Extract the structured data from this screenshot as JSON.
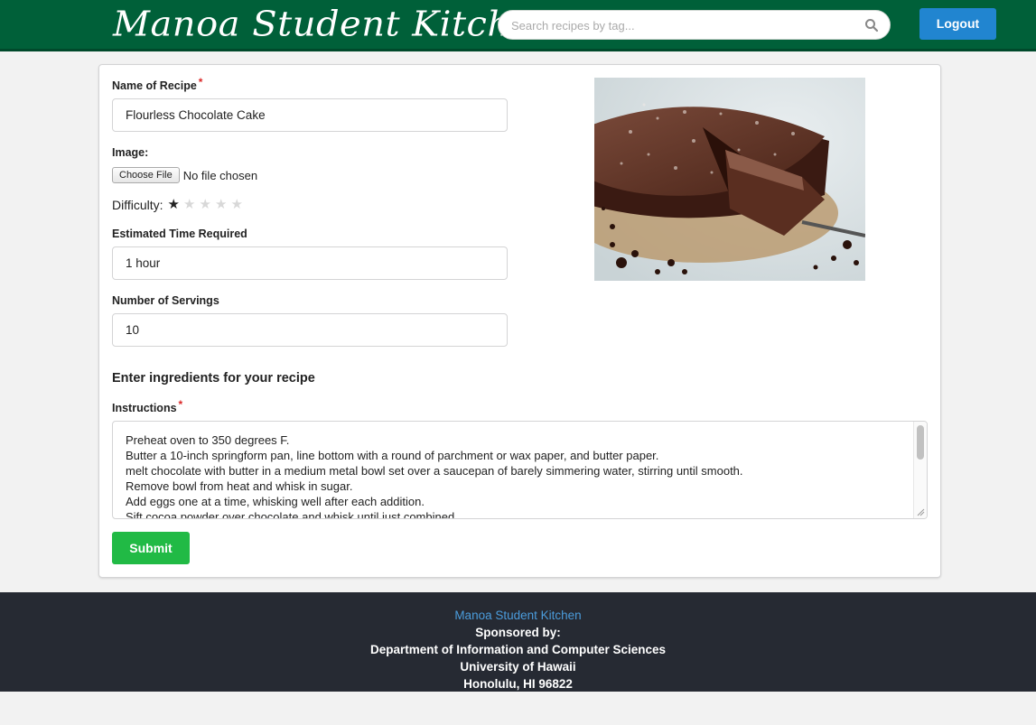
{
  "header": {
    "brand": "Manoa Student Kitchen",
    "search_placeholder": "Search recipes by tag...",
    "logout_label": "Logout"
  },
  "form": {
    "name_label": "Name of Recipe",
    "name_value": "Flourless Chocolate Cake",
    "image_label": "Image:",
    "file_button": "Choose File",
    "file_status": "No file chosen",
    "difficulty_label": "Difficulty:",
    "difficulty_rating": 1,
    "difficulty_max": 5,
    "time_label": "Estimated Time Required",
    "time_value": "1 hour",
    "servings_label": "Number of Servings",
    "servings_value": "10",
    "ingredients_title": "Enter ingredients for your recipe",
    "instructions_label": "Instructions",
    "instructions_lines": [
      "Preheat oven to 350 degrees F.",
      "Butter a 10-inch springform pan, line bottom with a round of parchment or wax paper, and butter paper.",
      "melt chocolate with butter in a medium metal bowl set over a saucepan of barely simmering water, stirring until smooth.",
      "Remove bowl from heat and whisk in sugar.",
      "Add eggs one at a time, whisking well after each addition.",
      "Sift cocoa powder over chocolate and whisk until just combined."
    ],
    "submit_label": "Submit"
  },
  "footer": {
    "link": "Manoa Student Kitchen",
    "sponsored": "Sponsored by:",
    "department": "Department of Information and Computer Sciences",
    "university": "University of Hawaii",
    "address": "Honolulu, HI 96822"
  },
  "colors": {
    "header_bg": "#006039",
    "logout_bg": "#2185d0",
    "submit_bg": "#21ba45",
    "footer_bg": "#262a33",
    "footer_link": "#4b9cdc"
  },
  "icons": {
    "search": "search-icon",
    "star": "star-icon",
    "resize": "resize-handle-icon"
  }
}
